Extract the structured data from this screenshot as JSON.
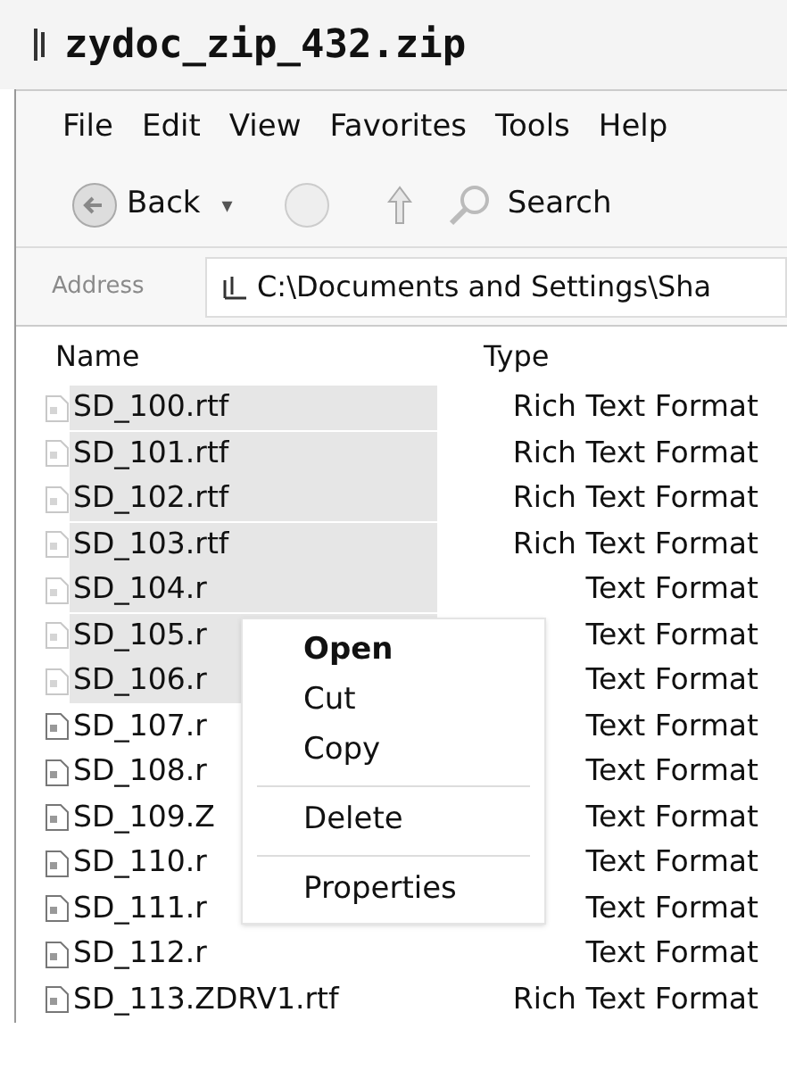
{
  "window": {
    "title": "zydoc_zip_432.zip"
  },
  "menu_bar": [
    "File",
    "Edit",
    "View",
    "Favorites",
    "Tools",
    "Help"
  ],
  "toolbar": {
    "back": "Back",
    "back_caret": "▾",
    "search": "Search"
  },
  "address": {
    "label": "Address",
    "value": "C:\\Documents and Settings\\Sha"
  },
  "table": {
    "columns": [
      "Name",
      "Type"
    ],
    "rows": [
      {
        "name": "SD_100.rtf",
        "type": "Rich Text Format",
        "selected": true
      },
      {
        "name": "SD_101.rtf",
        "type": "Rich Text Format",
        "selected": true
      },
      {
        "name": "SD_102.rtf",
        "type": "Rich Text Format",
        "selected": true
      },
      {
        "name": "SD_103.rtf",
        "type": "Rich Text Format",
        "selected": true
      },
      {
        "name": "SD_104.r",
        "type": "Text Format",
        "selected": true
      },
      {
        "name": "SD_105.r",
        "type": "Text Format",
        "selected": true
      },
      {
        "name": "SD_106.r",
        "type": "Text Format",
        "selected": true
      },
      {
        "name": "SD_107.r",
        "type": "Text Format",
        "selected": false
      },
      {
        "name": "SD_108.r",
        "type": "Text Format",
        "selected": false
      },
      {
        "name": "SD_109.Z",
        "type": "Text Format",
        "selected": false
      },
      {
        "name": "SD_110.r",
        "type": "Text Format",
        "selected": false
      },
      {
        "name": "SD_111.r",
        "type": "Text Format",
        "selected": false
      },
      {
        "name": "SD_112.r",
        "type": "Text Format",
        "selected": false
      },
      {
        "name": "SD_113.ZDRV1.rtf",
        "type": "Rich Text Format",
        "selected": false
      }
    ]
  },
  "context_menu": [
    {
      "label": "Open",
      "kind": "default"
    },
    {
      "label": "Cut",
      "kind": "item"
    },
    {
      "label": "Copy",
      "kind": "item"
    },
    {
      "kind": "separator"
    },
    {
      "label": "Delete",
      "kind": "item"
    },
    {
      "kind": "separator"
    },
    {
      "label": "Properties",
      "kind": "item"
    }
  ]
}
